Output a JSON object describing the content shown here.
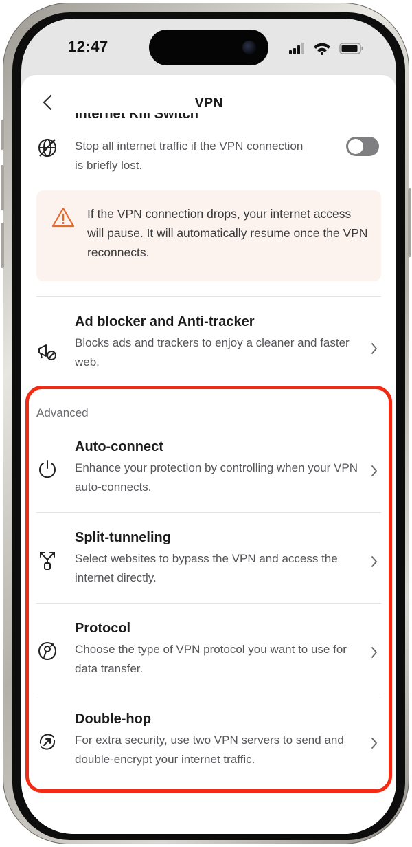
{
  "status_bar": {
    "time": "12:47"
  },
  "header": {
    "title": "VPN"
  },
  "kill_switch": {
    "title_partial": "Internet Kill Switch",
    "description": "Stop all internet traffic if the VPN connection is briefly lost.",
    "toggle_on": false
  },
  "warning": {
    "text": "If the VPN connection drops, your internet access will pause. It will automatically resume once the VPN reconnects."
  },
  "ad_blocker": {
    "title": "Ad blocker and Anti-tracker",
    "description": "Blocks ads and trackers to enjoy a cleaner and faster web."
  },
  "advanced": {
    "section_label": "Advanced",
    "items": [
      {
        "title": "Auto-connect",
        "description": "Enhance your protection by controlling when your VPN auto-connects.",
        "icon": "power-icon"
      },
      {
        "title": "Split-tunneling",
        "description": "Select websites to bypass the VPN and access the internet directly.",
        "icon": "split-icon"
      },
      {
        "title": "Protocol",
        "description": "Choose the type of VPN protocol you want to use for data transfer.",
        "icon": "protocol-icon"
      },
      {
        "title": "Double-hop",
        "description": "For extra security, use two VPN servers to send and double-encrypt your internet traffic.",
        "icon": "double-hop-icon"
      }
    ]
  },
  "colors": {
    "highlight": "#f42b14",
    "warning_bg": "#fdf3ee",
    "warning_icon": "#e8692b",
    "toggle_off": "#7f7f82"
  }
}
